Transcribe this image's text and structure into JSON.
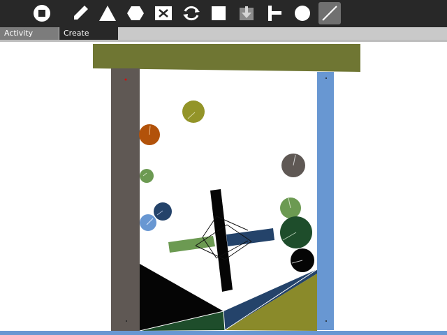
{
  "app": {
    "tools": [
      {
        "icon": "stop-icon"
      },
      {
        "icon": "pencil-icon"
      },
      {
        "icon": "triangle-icon"
      },
      {
        "icon": "hexagon-icon"
      },
      {
        "icon": "delete-box-icon"
      },
      {
        "icon": "rotate-icon"
      },
      {
        "icon": "square-icon"
      },
      {
        "icon": "import-icon"
      },
      {
        "icon": "joint-icon"
      },
      {
        "icon": "circle-icon"
      },
      {
        "icon": "line-icon",
        "selected": true
      }
    ],
    "tabs": {
      "activity_label": "Activity",
      "create_label": "Create"
    }
  },
  "colors": {
    "toolbar": "#282828",
    "olive": "#6f7633",
    "gray_wall": "#5f5854",
    "blue_wall": "#6897d2",
    "dark_blue": "#24436a",
    "green": "#6c9a52",
    "dark_green": "#1e4d2b",
    "orange": "#b2520a",
    "olive_ball": "#939428"
  }
}
